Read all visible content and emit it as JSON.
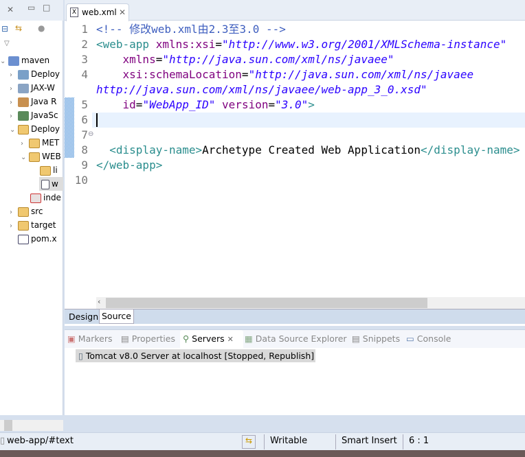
{
  "explorer": {
    "items": [
      {
        "label": "maven",
        "expanded": true
      },
      {
        "label": "Deploy"
      },
      {
        "label": "JAX-W"
      },
      {
        "label": "Java R"
      },
      {
        "label": "JavaSc"
      },
      {
        "label": "Deploy",
        "expanded": true
      },
      {
        "label": "MET"
      },
      {
        "label": "WEB",
        "expanded": true
      },
      {
        "label": "li"
      },
      {
        "label": "w"
      },
      {
        "label": "inde"
      },
      {
        "label": "src"
      },
      {
        "label": "target"
      },
      {
        "label": "pom.x"
      }
    ]
  },
  "editor": {
    "tab_label": "web.xml",
    "lines": {
      "l1": "<!-- 修改web.xml由2.3至3.0 -->",
      "l2a": "<web-app ",
      "l2b": "xmlns:xsi",
      "l2c": "=",
      "l2d": "\"http://www.w3.org/2001/XMLSchema-instance\"",
      "l3a": "    xmlns",
      "l3b": "=",
      "l3c": "\"http://java.sun.com/xml/ns/javaee\"",
      "l4a": "    xsi:schemaLocation",
      "l4b": "=",
      "l4c": "\"http://java.sun.com/xml/ns/javaee http://java.sun.com/xml/ns/javaee/web-app_3_0.xsd\"",
      "l5a": "    id",
      "l5b": "=",
      "l5c": "\"WebApp_ID\"",
      "l5d": " version",
      "l5e": "=",
      "l5f": "\"3.0\"",
      "l5g": ">",
      "l8a": "  <display-name>",
      "l8b": "Archetype Created Web Application",
      "l8c": "</display-name>",
      "l9": "</web-app>"
    },
    "line_numbers": [
      "1",
      "2",
      "3",
      "4",
      "5",
      "6",
      "7",
      "8",
      "9",
      "10"
    ],
    "design_tab": "Design",
    "source_tab": "Source"
  },
  "views": {
    "tabs": [
      "Markers",
      "Properties",
      "Servers",
      "Data Source Explorer",
      "Snippets",
      "Console"
    ],
    "active": "Servers",
    "server_entry": "Tomcat v8.0 Server at localhost  [Stopped, Republish]"
  },
  "status": {
    "path": "web-app/#text",
    "writable": "Writable",
    "insert_mode": "Smart Insert",
    "position": "6 : 1"
  }
}
